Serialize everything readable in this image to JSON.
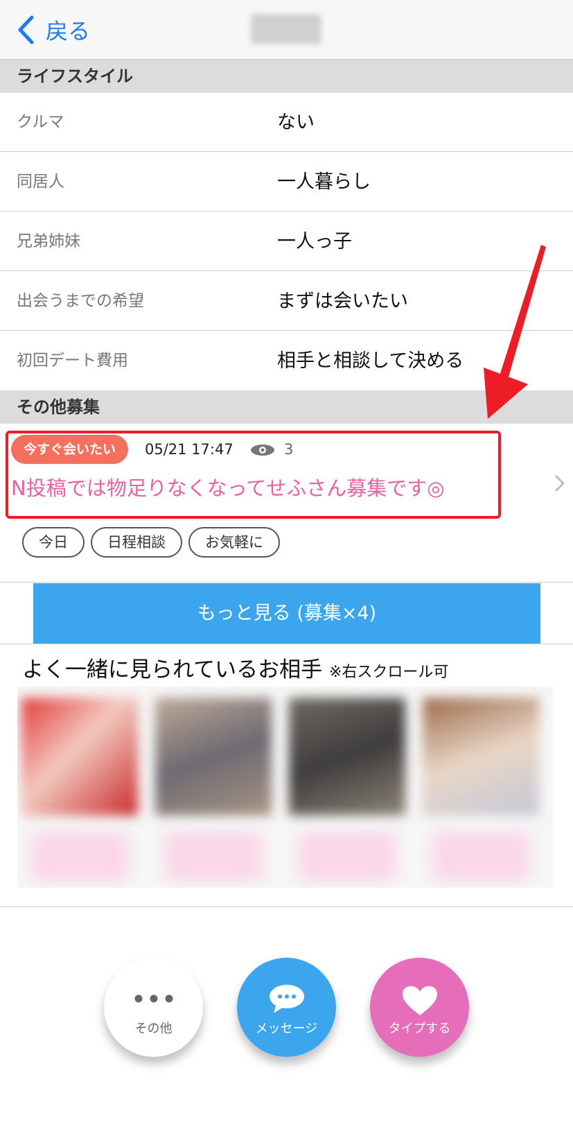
{
  "nav": {
    "back_label": "戻る"
  },
  "lifestyle": {
    "header": "ライフスタイル",
    "rows": [
      {
        "label": "クルマ",
        "value": "ない"
      },
      {
        "label": "同居人",
        "value": "一人暮らし"
      },
      {
        "label": "兄弟姉妹",
        "value": "一人っ子"
      },
      {
        "label": "出会うまでの希望",
        "value": "まずは会いたい"
      },
      {
        "label": "初回デート費用",
        "value": "相手と相談して決める"
      }
    ]
  },
  "recruit": {
    "header": "その他募集",
    "badge": "今すぐ会いたい",
    "datetime": "05/21 17:47",
    "views": "3",
    "title": "N投稿では物足りなくなってせふさん募集です◎",
    "tags": [
      "今日",
      "日程相談",
      "お気軽に"
    ]
  },
  "more_button": "もっと見る (募集×4)",
  "suggestions": {
    "title": "よく一緒に見られているお相手",
    "note": "※右スクロール可"
  },
  "actions": {
    "other": "その他",
    "message": "メッセージ",
    "like": "タイプする"
  },
  "colors": {
    "accent_blue": "#3ba6ee",
    "like_pink": "#e56dba",
    "badge_orange": "#f4705d",
    "title_pink": "#ee5fa0",
    "annotation_red": "#ee1c24"
  }
}
